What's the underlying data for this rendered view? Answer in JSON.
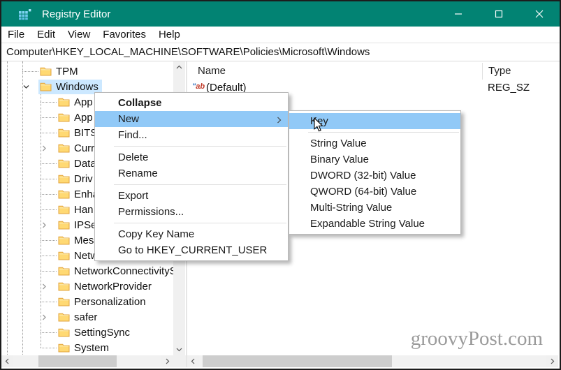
{
  "window": {
    "title": "Registry Editor"
  },
  "menubar": {
    "items": [
      "File",
      "Edit",
      "View",
      "Favorites",
      "Help"
    ]
  },
  "addressbar": {
    "value": "Computer\\HKEY_LOCAL_MACHINE\\SOFTWARE\\Policies\\Microsoft\\Windows"
  },
  "tree": {
    "items": [
      {
        "label": "TPM",
        "level": 2,
        "chevron": "none",
        "selected": false
      },
      {
        "label": "Windows",
        "level": 2,
        "chevron": "expanded",
        "selected": true
      },
      {
        "label": "App",
        "level": 3,
        "chevron": "none",
        "selected": false
      },
      {
        "label": "App",
        "level": 3,
        "chevron": "none",
        "selected": false
      },
      {
        "label": "BITS",
        "level": 3,
        "chevron": "none",
        "selected": false
      },
      {
        "label": "Curr",
        "level": 3,
        "chevron": "collapsed",
        "selected": false
      },
      {
        "label": "Data",
        "level": 3,
        "chevron": "none",
        "selected": false
      },
      {
        "label": "Driv",
        "level": 3,
        "chevron": "none",
        "selected": false
      },
      {
        "label": "Enha",
        "level": 3,
        "chevron": "none",
        "selected": false
      },
      {
        "label": "Han",
        "level": 3,
        "chevron": "none",
        "selected": false
      },
      {
        "label": "IPSe",
        "level": 3,
        "chevron": "collapsed",
        "selected": false
      },
      {
        "label": "Mes",
        "level": 3,
        "chevron": "none",
        "selected": false
      },
      {
        "label": "Netw",
        "level": 3,
        "chevron": "none",
        "selected": false
      },
      {
        "label": "NetworkConnectivityS",
        "level": 3,
        "chevron": "none",
        "selected": false
      },
      {
        "label": "NetworkProvider",
        "level": 3,
        "chevron": "collapsed",
        "selected": false
      },
      {
        "label": "Personalization",
        "level": 3,
        "chevron": "none",
        "selected": false
      },
      {
        "label": "safer",
        "level": 3,
        "chevron": "collapsed",
        "selected": false
      },
      {
        "label": "SettingSync",
        "level": 3,
        "chevron": "none",
        "selected": false
      },
      {
        "label": "System",
        "level": 3,
        "chevron": "none",
        "selected": false
      }
    ]
  },
  "list": {
    "columns": [
      "Name",
      "Type"
    ],
    "rows": [
      {
        "name": "(Default)",
        "type": "REG_SZ",
        "icon": "string-value-icon"
      }
    ]
  },
  "context_menu": {
    "items": [
      {
        "label": "Collapse",
        "bold": true
      },
      {
        "label": "New",
        "highlighted": true,
        "has_submenu": true
      },
      {
        "label": "Find..."
      },
      {
        "separator": true
      },
      {
        "label": "Delete"
      },
      {
        "label": "Rename"
      },
      {
        "separator": true
      },
      {
        "label": "Export"
      },
      {
        "label": "Permissions..."
      },
      {
        "separator": true
      },
      {
        "label": "Copy Key Name"
      },
      {
        "label": "Go to HKEY_CURRENT_USER"
      }
    ]
  },
  "submenu": {
    "items": [
      {
        "label": "Key",
        "highlighted": true
      },
      {
        "separator": true
      },
      {
        "label": "String Value"
      },
      {
        "label": "Binary Value"
      },
      {
        "label": "DWORD (32-bit) Value"
      },
      {
        "label": "QWORD (64-bit) Value"
      },
      {
        "label": "Multi-String Value"
      },
      {
        "label": "Expandable String Value"
      }
    ]
  },
  "watermark": {
    "text": "groovyPost.com"
  },
  "colors": {
    "titlebar": "#028373",
    "menu_highlight": "#91c9f7",
    "tree_selection": "#cce8ff",
    "folder": "#ffd973",
    "folder_edge": "#e2a33d"
  }
}
